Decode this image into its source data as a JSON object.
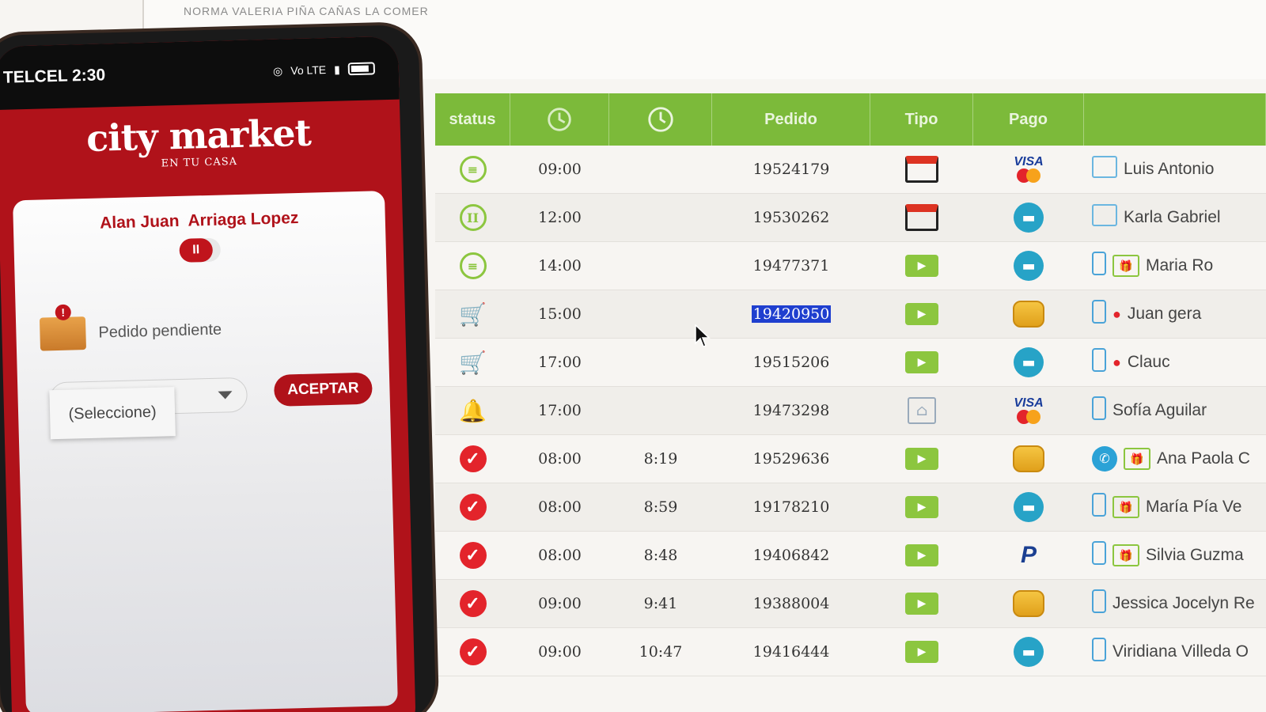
{
  "monitor": {
    "top_text": "NORMA VALERIA PIÑA CAÑAS LA COMER",
    "headers": {
      "status": "status",
      "pedido": "Pedido",
      "tipo": "Tipo",
      "pago": "Pago"
    },
    "rows": [
      {
        "status": "list",
        "hora": "09:00",
        "real": "",
        "pedido": "19524179",
        "tipo": "store",
        "pago": "visa",
        "canal": "pc",
        "extra": "",
        "cliente": "Luis Antonio"
      },
      {
        "status": "pause",
        "hora": "12:00",
        "real": "",
        "pedido": "19530262",
        "tipo": "store",
        "pago": "card",
        "canal": "pc",
        "extra": "",
        "cliente": "Karla Gabriel"
      },
      {
        "status": "list",
        "hora": "14:00",
        "real": "",
        "pedido": "19477371",
        "tipo": "truck",
        "pago": "card",
        "canal": "phone",
        "extra": "gift",
        "cliente": "Maria Ro"
      },
      {
        "status": "cart",
        "hora": "15:00",
        "real": "",
        "pedido": "19420950",
        "tipo": "truck",
        "pago": "coin",
        "canal": "phone",
        "extra": "sale",
        "cliente": "Juan gera",
        "selected": true
      },
      {
        "status": "cart",
        "hora": "17:00",
        "real": "",
        "pedido": "19515206",
        "tipo": "truck",
        "pago": "card",
        "canal": "phone",
        "extra": "sale",
        "cliente": "Clauc"
      },
      {
        "status": "bell",
        "hora": "17:00",
        "real": "",
        "pedido": "19473298",
        "tipo": "storefront",
        "pago": "visa",
        "canal": "phone",
        "extra": "",
        "cliente": "Sofía Aguilar"
      },
      {
        "status": "check",
        "hora": "08:00",
        "real": "8:19",
        "pedido": "19529636",
        "tipo": "truck",
        "pago": "coin",
        "canal": "whatsapp",
        "extra": "gift",
        "cliente": "Ana Paola C"
      },
      {
        "status": "check",
        "hora": "08:00",
        "real": "8:59",
        "pedido": "19178210",
        "tipo": "truck",
        "pago": "card",
        "canal": "phone",
        "extra": "gift",
        "cliente": "María Pía Ve"
      },
      {
        "status": "check",
        "hora": "08:00",
        "real": "8:48",
        "pedido": "19406842",
        "tipo": "truck",
        "pago": "paypal",
        "canal": "phone",
        "extra": "gift",
        "cliente": "Silvia Guzma"
      },
      {
        "status": "check",
        "hora": "09:00",
        "real": "9:41",
        "pedido": "19388004",
        "tipo": "truck",
        "pago": "coin",
        "canal": "phone",
        "extra": "",
        "cliente": "Jessica Jocelyn Re"
      },
      {
        "status": "check",
        "hora": "09:00",
        "real": "10:47",
        "pedido": "19416444",
        "tipo": "truck",
        "pago": "card",
        "canal": "phone",
        "extra": "",
        "cliente": "Viridiana Villeda O"
      }
    ],
    "colors": {
      "header_green": "#7cba3a",
      "check_red": "#e3242b",
      "selection_blue": "#1f3fcf"
    }
  },
  "phone": {
    "status_left": "TELCEL 2:30",
    "status_icons": [
      "whatsapp-icon",
      "sim-icon",
      "wifi-icon",
      "volte-icon",
      "signal-icon",
      "battery-icon"
    ],
    "brand_logo": "city market",
    "brand_tag": "EN TU CASA",
    "user_first": "Alan Juan",
    "user_last": "Arriaga Lopez",
    "toggle_label": "II",
    "pending_label": "Pedido pendiente",
    "select_value": "(Seleccione)",
    "accept_label": "ACEPTAR",
    "volte_text": "Vo LTE",
    "colors": {
      "brand_red": "#b0121a"
    }
  }
}
